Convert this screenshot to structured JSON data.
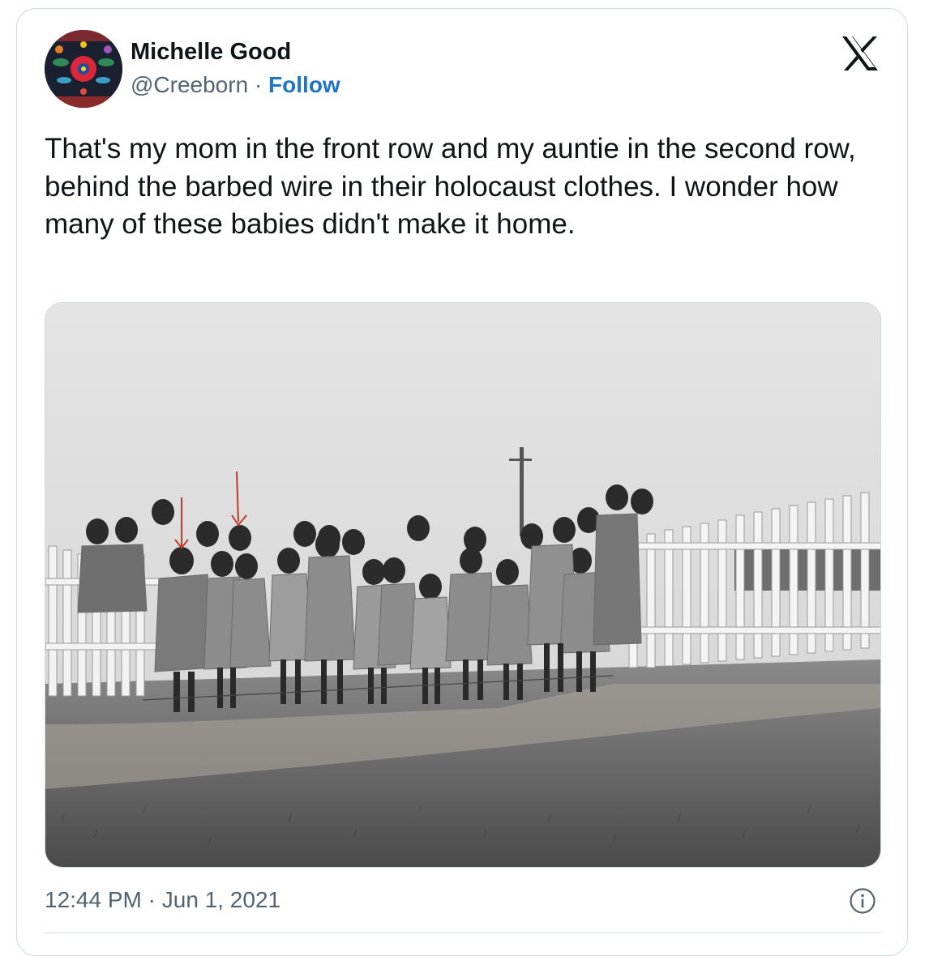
{
  "author": {
    "name": "Michelle Good",
    "handle": "@Creeborn",
    "separator": "·",
    "follow_label": "Follow"
  },
  "logo_icon": "x-logo-icon",
  "tweet": {
    "text": "That's my mom in the front row and my auntie in the second row, behind the barbed wire in their holocaust clothes. I wonder how many of these babies didn't make it home."
  },
  "timestamp": {
    "time": "12:44 PM",
    "separator": "·",
    "date": "Jun 1, 2021"
  },
  "colors": {
    "text": "#0f1419",
    "secondary": "#536471",
    "follow": "#1d74c8",
    "border": "#cfd9de",
    "annotation_arrow": "#c0392b"
  }
}
